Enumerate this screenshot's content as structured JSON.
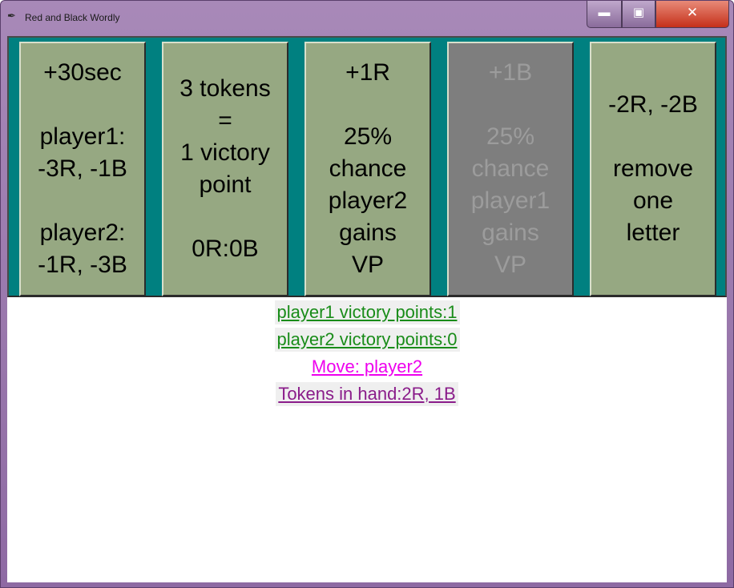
{
  "window": {
    "title": "Red and Black Wordly",
    "title_icon": "feather-icon",
    "controls": {
      "minimize": "▬",
      "maximize": "▣",
      "close": "✕"
    }
  },
  "cards": [
    {
      "text": "+30sec\n\nplayer1:\n-3R, -1B\n\nplayer2:\n-1R, -3B",
      "enabled": true
    },
    {
      "text": "3 tokens\n=\n1 victory\npoint\n\n0R:0B",
      "enabled": true
    },
    {
      "text": "+1R\n\n25%\nchance\nplayer2\ngains\nVP",
      "enabled": true
    },
    {
      "text": "+1B\n\n25%\nchance\nplayer1\ngains\nVP",
      "enabled": false
    },
    {
      "text": "-2R, -2B\n\nremove\none\nletter",
      "enabled": true
    }
  ],
  "status": {
    "p1_vp": "player1 victory points:1",
    "p2_vp": "player2 victory points:0",
    "move": "Move: player2",
    "tokens": "Tokens in hand:2R, 1B"
  },
  "colors": {
    "panel_bg": "#008080",
    "card_bg": "#96a882",
    "card_disabled_bg": "#7e7e7e",
    "vp_text": "#198c19",
    "move_text": "#ee00ee",
    "tokens_text": "#8a1c8a"
  }
}
